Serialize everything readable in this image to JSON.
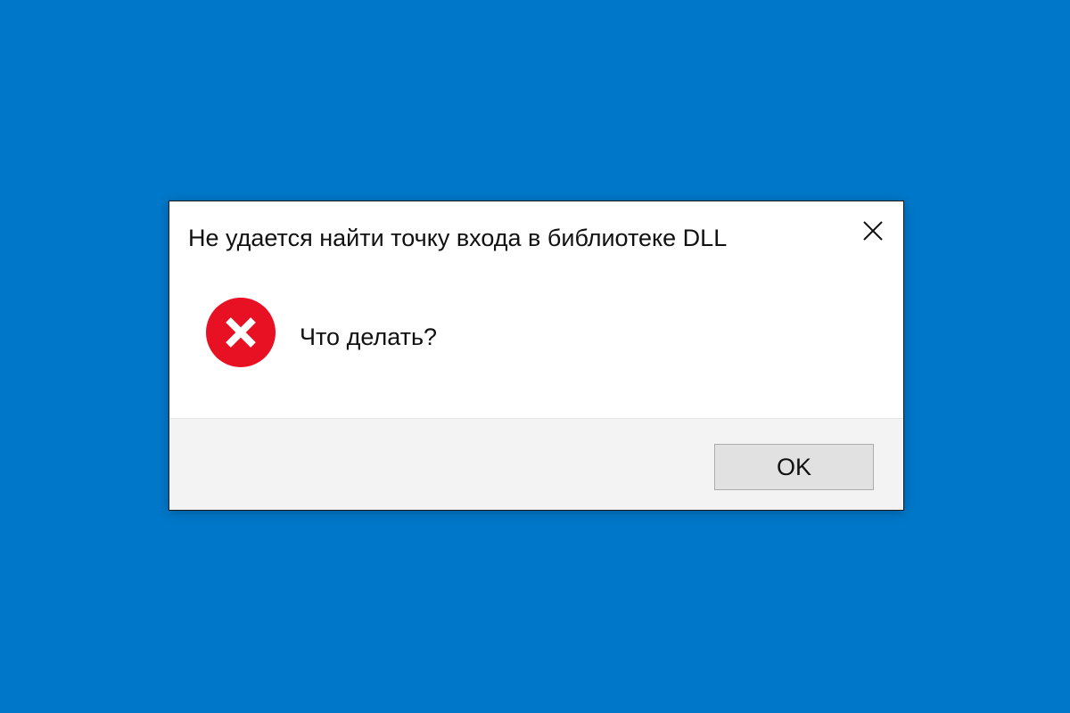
{
  "desktop": {
    "background_color": "#0077c8"
  },
  "dialog": {
    "title": "Не удается найти точку входа в библиотеке DLL",
    "close_icon": "close-icon",
    "message": "Что делать?",
    "error_icon": "error-icon",
    "error_color": "#e81123",
    "ok_label": "OK"
  }
}
